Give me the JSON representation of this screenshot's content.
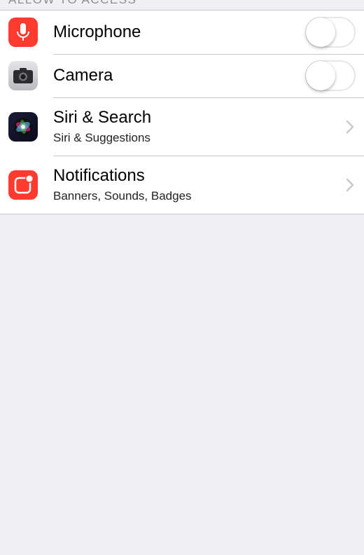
{
  "section": {
    "header": "ALLOW TO ACCESS"
  },
  "rows": [
    {
      "title": "Microphone",
      "icon": "microphone-icon",
      "control": "toggle",
      "state": "off"
    },
    {
      "title": "Camera",
      "icon": "camera-icon",
      "control": "toggle",
      "state": "off"
    },
    {
      "title": "Siri & Search",
      "subtitle": "Siri & Suggestions",
      "icon": "siri-icon",
      "control": "chevron"
    },
    {
      "title": "Notifications",
      "subtitle": "Banners, Sounds, Badges",
      "icon": "notifications-icon",
      "control": "chevron"
    }
  ],
  "colors": {
    "background": "#efeff4",
    "separator": "#c8c7cc",
    "microphone_icon": "#ff3b30",
    "notifications_icon": "#ff3b30",
    "chevron": "#c7c7cc"
  }
}
